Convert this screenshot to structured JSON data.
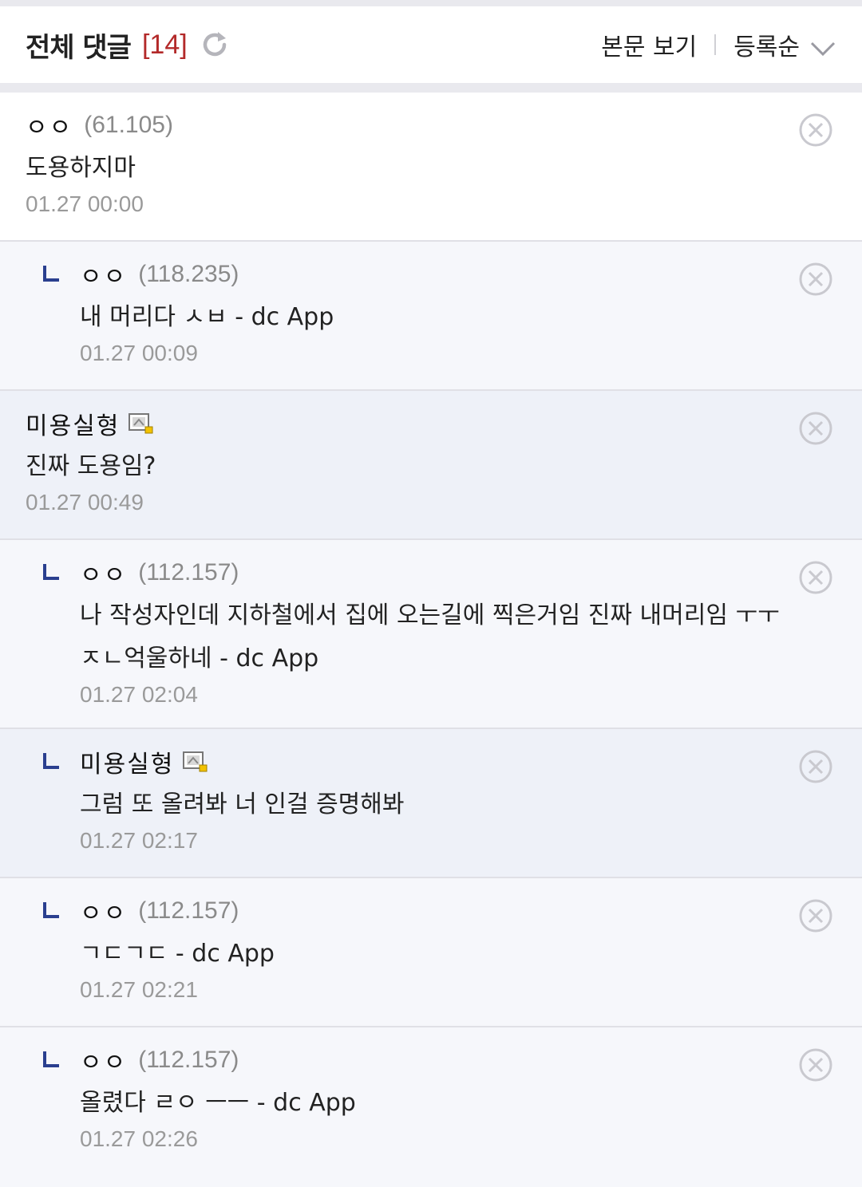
{
  "header": {
    "title": "전체 댓글",
    "count": "[14]",
    "view_post_label": "본문 보기",
    "sort_label": "등록순"
  },
  "comments": [
    {
      "nick": "ㅇㅇ",
      "ip": "(61.105)",
      "text": "도용하지마",
      "date": "01.27 00:00",
      "reply": false,
      "gallog": false
    },
    {
      "nick": "ㅇㅇ",
      "ip": "(118.235)",
      "text": "내 머리다 ㅅㅂ - dc App",
      "date": "01.27 00:09",
      "reply": true,
      "gallog": false
    },
    {
      "nick": "미용실형",
      "ip": "",
      "text": "진짜 도용임?",
      "date": "01.27 00:49",
      "reply": false,
      "gallog": true
    },
    {
      "nick": "ㅇㅇ",
      "ip": "(112.157)",
      "text": "나 작성자인데 지하철에서 집에 오는길에 찍은거임 진짜 내머리임 ㅜㅜ ㅈㄴ억울하네 - dc App",
      "date": "01.27 02:04",
      "reply": true,
      "gallog": false
    },
    {
      "nick": "미용실형",
      "ip": "",
      "text": "그럼 또 올려봐 너 인걸 증명해봐",
      "date": "01.27 02:17",
      "reply": true,
      "gallog": true
    },
    {
      "nick": "ㅇㅇ",
      "ip": "(112.157)",
      "text": "ㄱㄷㄱㄷ - dc App",
      "date": "01.27 02:21",
      "reply": true,
      "gallog": false
    },
    {
      "nick": "ㅇㅇ",
      "ip": "(112.157)",
      "text": "올렸다 ㄹㅇ ㅡㅡ - dc App",
      "date": "01.27 02:26",
      "reply": true,
      "gallog": false
    }
  ],
  "colors": {
    "accent_count": "#b32a2a",
    "reply_mark": "#2a3f8f"
  }
}
